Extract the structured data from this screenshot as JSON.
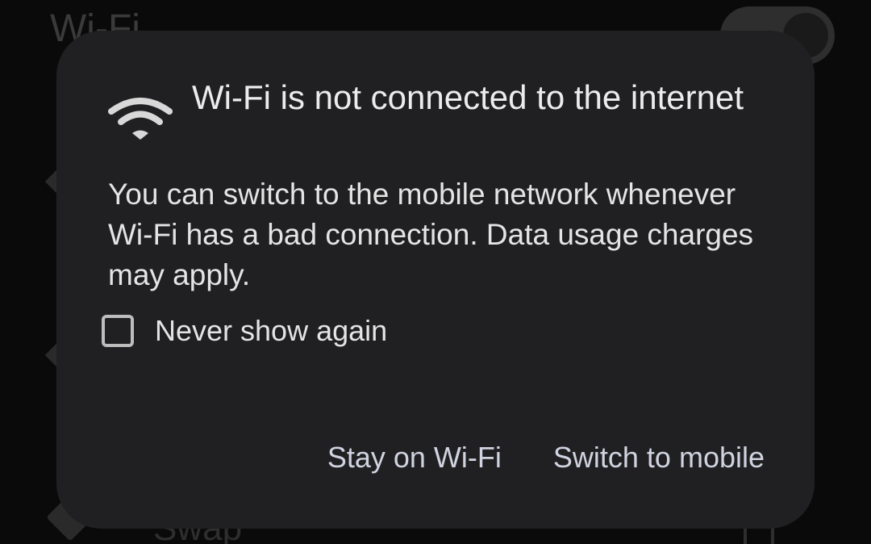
{
  "background": {
    "setting_title": "Wi-Fi",
    "bottom_item_text": "Swap"
  },
  "dialog": {
    "icon": "wifi-icon",
    "title": "Wi-Fi is not connected to the internet",
    "message": "You can switch to the mobile network whenever Wi-Fi has a bad connection. Data usage charges may apply.",
    "checkbox": {
      "label": "Never show again",
      "checked": false
    },
    "actions": {
      "stay_label": "Stay on Wi-Fi",
      "switch_label": "Switch to mobile"
    }
  },
  "colors": {
    "dialog_bg": "#202022",
    "text_primary": "#ececec",
    "action_text": "#d0d3e0"
  }
}
